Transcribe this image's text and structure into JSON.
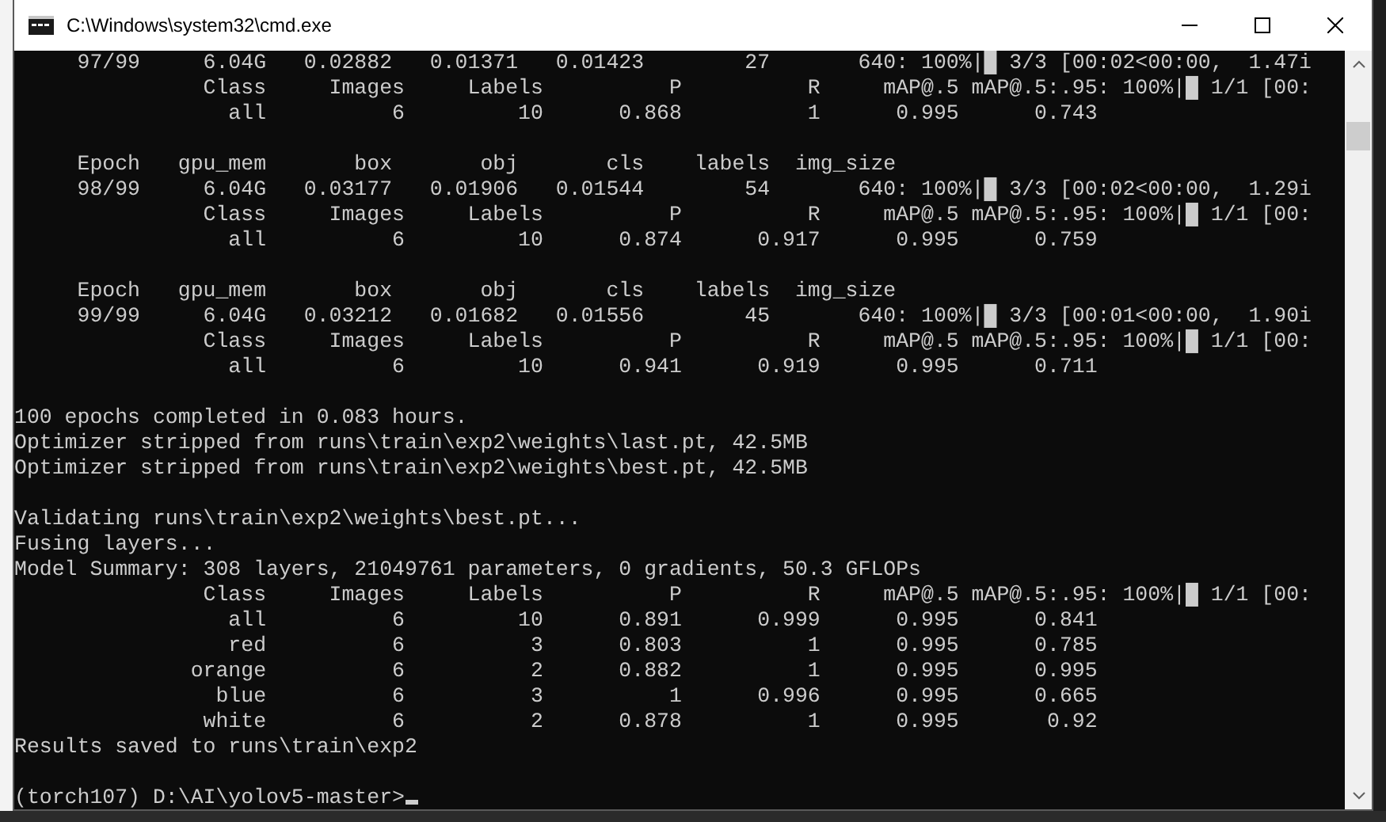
{
  "window": {
    "title": "C:\\Windows\\system32\\cmd.exe"
  },
  "terminal": {
    "blocks": [
      [
        "     97/99     6.04G   0.02882   0.01371   0.01423        27       640: 100%|█ 3/3 [00:02<00:00,  1.47i",
        "               Class     Images     Labels          P          R     mAP@.5 mAP@.5:.95: 100%|█ 1/1 [00:",
        "                 all          6         10      0.868          1      0.995      0.743"
      ],
      [
        "     Epoch   gpu_mem       box       obj       cls    labels  img_size",
        "     98/99     6.04G   0.03177   0.01906   0.01544        54       640: 100%|█ 3/3 [00:02<00:00,  1.29i",
        "               Class     Images     Labels          P          R     mAP@.5 mAP@.5:.95: 100%|█ 1/1 [00:",
        "                 all          6         10      0.874      0.917      0.995      0.759"
      ],
      [
        "     Epoch   gpu_mem       box       obj       cls    labels  img_size",
        "     99/99     6.04G   0.03212   0.01682   0.01556        45       640: 100%|█ 3/3 [00:01<00:00,  1.90i",
        "               Class     Images     Labels          P          R     mAP@.5 mAP@.5:.95: 100%|█ 1/1 [00:",
        "                 all          6         10      0.941      0.919      0.995      0.711"
      ],
      [
        "100 epochs completed in 0.083 hours.",
        "Optimizer stripped from runs\\train\\exp2\\weights\\last.pt, 42.5MB",
        "Optimizer stripped from runs\\train\\exp2\\weights\\best.pt, 42.5MB"
      ],
      [
        "Validating runs\\train\\exp2\\weights\\best.pt...",
        "Fusing layers... ",
        "Model Summary: 308 layers, 21049761 parameters, 0 gradients, 50.3 GFLOPs",
        "               Class     Images     Labels          P          R     mAP@.5 mAP@.5:.95: 100%|█ 1/1 [00:",
        "                 all          6         10      0.891      0.999      0.995      0.841",
        "                 red          6          3      0.803          1      0.995      0.785",
        "              orange          6          2      0.882          1      0.995      0.995",
        "                blue          6          3          1      0.996      0.995      0.665",
        "               white          6          2      0.878          1      0.995       0.92",
        "Results saved to runs\\train\\exp2"
      ]
    ],
    "prompt": "(torch107) D:\\AI\\yolov5-master>"
  }
}
